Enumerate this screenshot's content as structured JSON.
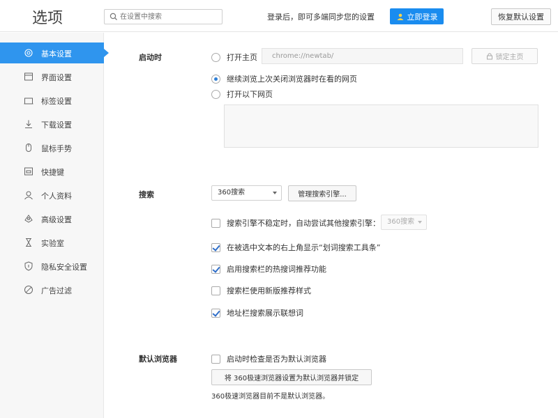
{
  "header": {
    "title": "选项",
    "search_placeholder": "在设置中搜索",
    "login_hint": "登录后，即可多端同步您的设置",
    "login_button": "立即登录",
    "restore_button": "恢复默认设置"
  },
  "sidebar": {
    "items": [
      {
        "label": "基本设置",
        "icon": "gear-icon",
        "active": true
      },
      {
        "label": "界面设置",
        "icon": "window-icon"
      },
      {
        "label": "标签设置",
        "icon": "tab-icon"
      },
      {
        "label": "下载设置",
        "icon": "download-icon"
      },
      {
        "label": "鼠标手势",
        "icon": "mouse-icon"
      },
      {
        "label": "快捷键",
        "icon": "keyboard-icon"
      },
      {
        "label": "个人资料",
        "icon": "user-icon"
      },
      {
        "label": "高级设置",
        "icon": "advanced-icon"
      },
      {
        "label": "实验室",
        "icon": "flask-icon"
      },
      {
        "label": "隐私安全设置",
        "icon": "shield-icon"
      },
      {
        "label": "广告过滤",
        "icon": "block-icon"
      }
    ]
  },
  "startup": {
    "title": "启动时",
    "option_homepage": "打开主页",
    "homepage_url": "chrome://newtab/",
    "lock_homepage": "锁定主页",
    "option_continue": "继续浏览上次关闭浏览器时在看的网页",
    "option_pages": "打开以下网页",
    "selected": "continue"
  },
  "search": {
    "title": "搜索",
    "engine": "360搜索",
    "manage_button": "管理搜索引擎...",
    "fallback_label": "搜索引擎不稳定时，自动尝试其他搜索引擎：",
    "fallback_engine": "360搜索",
    "fallback_checked": false,
    "show_toolbar_label": "在被选中文本的右上角显示“划词搜索工具条”",
    "show_toolbar_checked": true,
    "hot_words_label": "启用搜索栏的热搜词推荐功能",
    "hot_words_checked": true,
    "new_style_label": "搜索栏使用新版推荐样式",
    "new_style_checked": false,
    "address_suggest_label": "地址栏搜索展示联想词",
    "address_suggest_checked": true
  },
  "default_browser": {
    "title": "默认浏览器",
    "check_label": "启动时检查是否为默认浏览器",
    "check_checked": false,
    "set_button": "将 360极速浏览器设置为默认浏览器并锁定",
    "status": "360极速浏览器目前不是默认浏览器。"
  },
  "colors": {
    "accent": "#2f95ee",
    "login_button": "#1a8cef"
  }
}
